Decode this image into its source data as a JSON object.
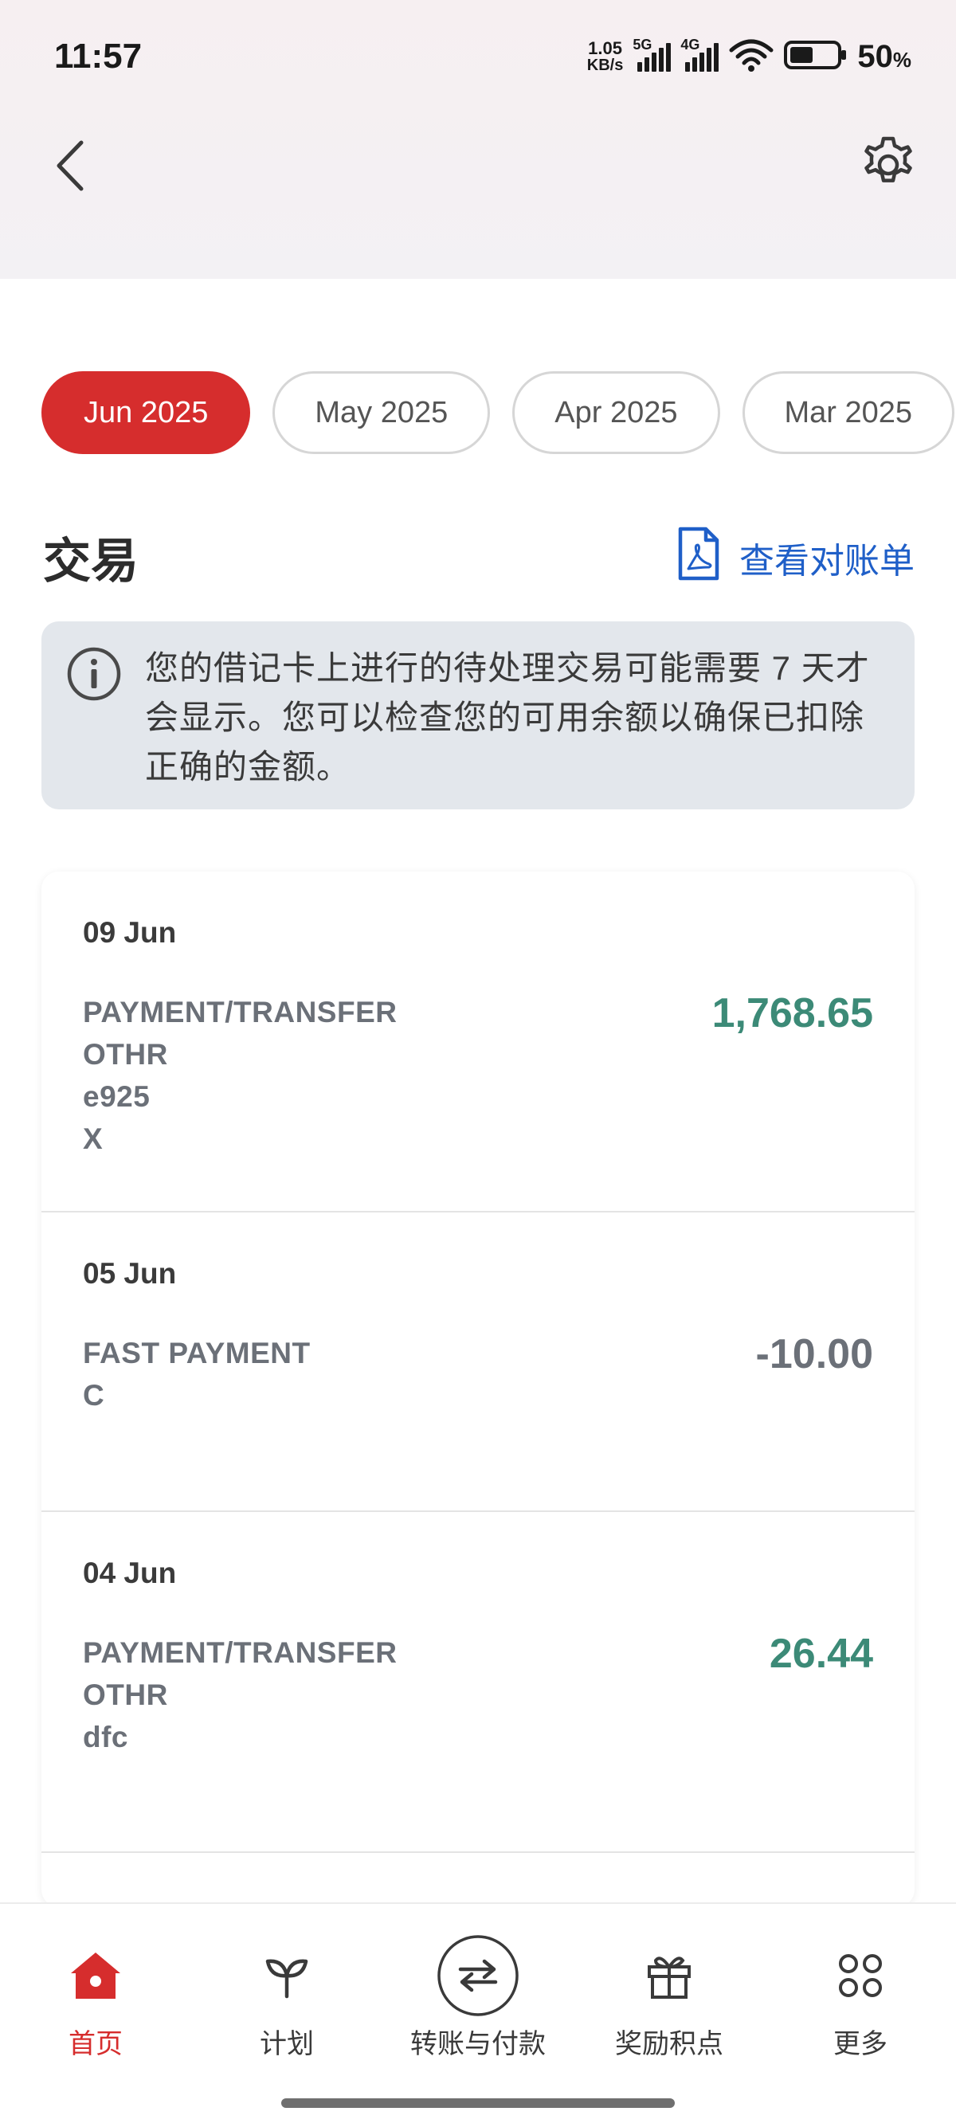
{
  "status_bar": {
    "time": "11:57",
    "net_speed_value": "1.05",
    "net_speed_unit": "KB/s",
    "sim1_tag": "5G",
    "sim2_tag": "4G",
    "battery_percent": "50",
    "battery_symbol": "%",
    "battery_level": 0.5
  },
  "app_bar": {
    "back_icon": "chevron-left-icon",
    "settings_icon": "gear-icon"
  },
  "months": {
    "items": [
      "Jun 2025",
      "May 2025",
      "Apr 2025",
      "Mar 2025"
    ],
    "selected": "Jun 2025"
  },
  "section": {
    "title": "交易",
    "statement_link": "查看对账单",
    "statement_icon": "pdf-document-icon"
  },
  "info_banner": {
    "icon": "info-icon",
    "text": "您的借记卡上进行的待处理交易可能需要 7 天才会显示。您可以检查您的可用余额以确保已扣除正确的金额。"
  },
  "transactions": [
    {
      "date": "09 Jun",
      "line1": "PAYMENT/TRANSFER",
      "line2": "OTHR",
      "line3": "e925",
      "line4": "X",
      "amount": "1,768.65",
      "type": "credit"
    },
    {
      "date": "05 Jun",
      "line1": "FAST PAYMENT",
      "line2": "C",
      "amount": "-10.00",
      "type": "debit"
    },
    {
      "date": "04 Jun",
      "line1": "PAYMENT/TRANSFER",
      "line2": "OTHR",
      "line3": "dfc",
      "amount": "26.44",
      "type": "credit"
    }
  ],
  "bottom_nav": {
    "items": [
      {
        "label": "首页",
        "icon": "home-icon",
        "active": true
      },
      {
        "label": "计划",
        "icon": "sprout-icon",
        "active": false
      },
      {
        "label": "转账与付款",
        "icon": "transfer-arrows-icon",
        "active": false
      },
      {
        "label": "奖励积点",
        "icon": "gift-icon",
        "active": false
      },
      {
        "label": "更多",
        "icon": "grid-dots-icon",
        "active": false
      }
    ]
  },
  "colors": {
    "brand_red": "#d62d2d",
    "link_blue": "#1f5fc8",
    "credit_green": "#3c8a77",
    "debit_grey": "#6b7078",
    "banner_bg": "#e3e7ec"
  }
}
